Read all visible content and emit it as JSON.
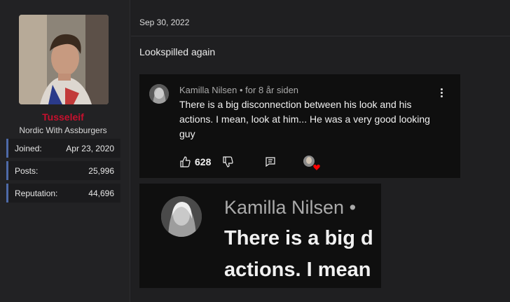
{
  "user": {
    "name": "Tusseleif",
    "name_color": "#c8102e",
    "title": "Nordic With Assburgers",
    "stats": [
      {
        "label": "Joined:",
        "value": "Apr 23, 2020"
      },
      {
        "label": "Posts:",
        "value": "25,996"
      },
      {
        "label": "Reputation:",
        "value": "44,696"
      }
    ]
  },
  "post": {
    "date": "Sep 30, 2022",
    "text": "Lookspilled again"
  },
  "embed_comment": {
    "author": "Kamilla Nilsen",
    "meta": "• for 8 år siden",
    "text": "There is a big disconnection between his look and his actions. I mean, look at him... He was a very good looking guy",
    "likes": "628"
  },
  "embed_zoom": {
    "author": "Kamilla Nilsen",
    "dot": "•",
    "line1": "There is a big d",
    "line2": "actions. I mean"
  }
}
